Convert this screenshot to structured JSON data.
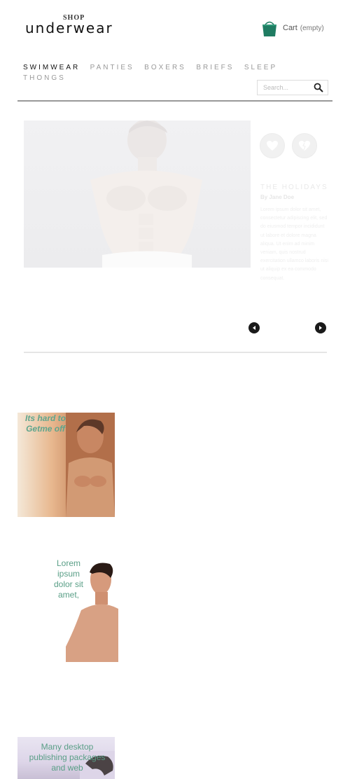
{
  "header": {
    "shop_label": "SHOP",
    "brand_label": "underwear"
  },
  "cart": {
    "label": "Cart",
    "status": "(empty)"
  },
  "nav": {
    "items": [
      {
        "label": "SWIMWEAR"
      },
      {
        "label": "PANTIES"
      },
      {
        "label": "BOXERS"
      },
      {
        "label": "BRIEFS"
      },
      {
        "label": "SLEEP"
      },
      {
        "label": "THONGS"
      }
    ]
  },
  "search": {
    "placeholder": "Search..."
  },
  "feature": {
    "title": "THE HOLIDAYS",
    "author": "By Jane Doe",
    "description": "Lorem ipsum dolor sit amet, consectetur adipiscing elit, sed do eiusmod tempor incididunt ut labore et dolore magna aliqua. Ut enim ad minim veniam, quis nostrud exercitation ullamco laboris nisi ut aliquip ex ea commodo consequat."
  },
  "banners": [
    {
      "text": "Its hard to Getme off"
    },
    {
      "text": "Lorem ipsum dolor sit amet,"
    },
    {
      "text": "Many desktop publishing packages and web"
    }
  ],
  "colors": {
    "cart_bag": "#1f7c62",
    "banner_text": "#5fa58d",
    "nav_active": "#111111",
    "nav_inactive": "#999999"
  }
}
